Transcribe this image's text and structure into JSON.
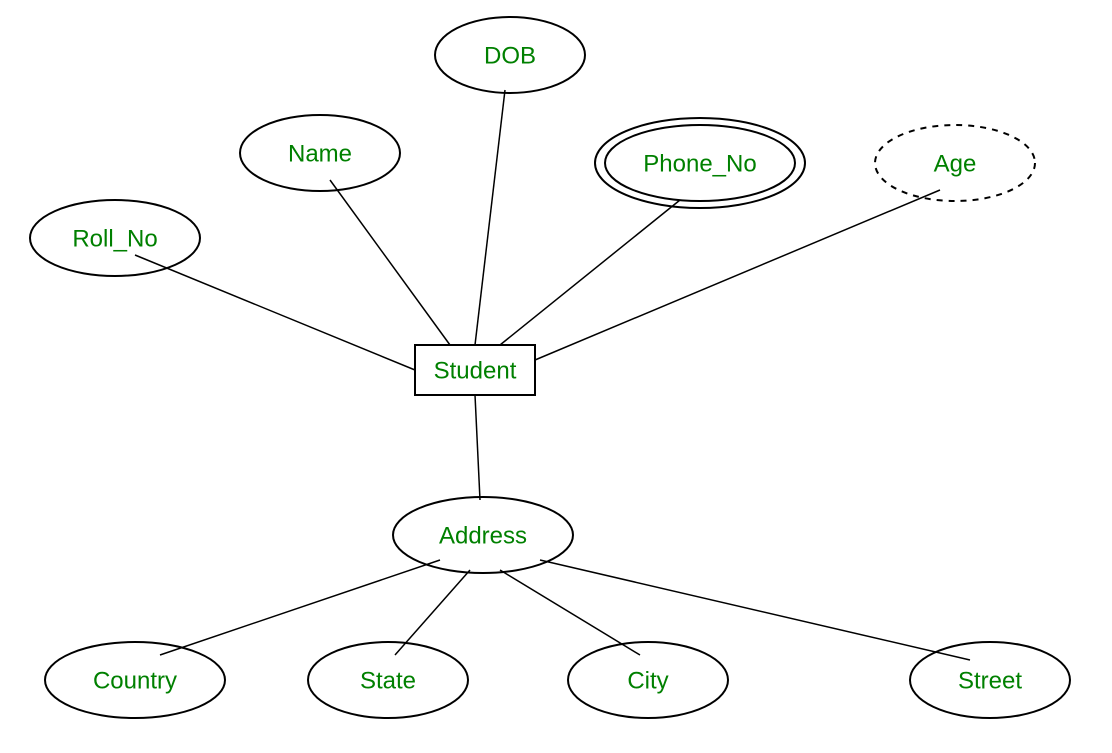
{
  "diagram": {
    "entity": {
      "label": "Student"
    },
    "attributes": {
      "roll_no": {
        "label": "Roll_No"
      },
      "name": {
        "label": "Name"
      },
      "dob": {
        "label": "DOB"
      },
      "phone_no": {
        "label": "Phone_No"
      },
      "age": {
        "label": "Age"
      },
      "address": {
        "label": "Address"
      },
      "country": {
        "label": "Country"
      },
      "state": {
        "label": "State"
      },
      "city": {
        "label": "City"
      },
      "street": {
        "label": "Street"
      }
    },
    "colors": {
      "text": "#008000",
      "stroke": "#000000",
      "background": "#ffffff"
    },
    "er_model": {
      "entity": "Student",
      "simple_attributes": [
        "Roll_No",
        "Name",
        "DOB"
      ],
      "multivalued_attributes": [
        "Phone_No"
      ],
      "derived_attributes": [
        "Age"
      ],
      "composite_attributes": {
        "Address": [
          "Country",
          "State",
          "City",
          "Street"
        ]
      }
    }
  }
}
